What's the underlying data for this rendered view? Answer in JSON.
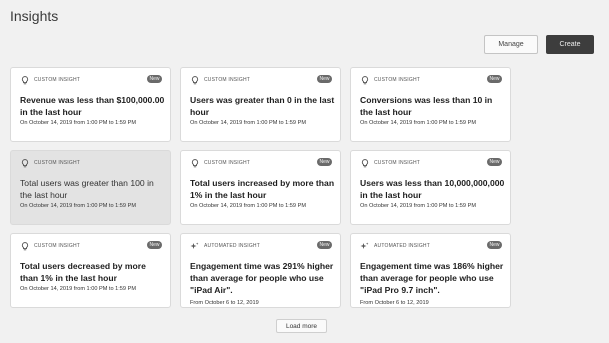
{
  "page": {
    "title": "Insights"
  },
  "toolbar": {
    "manage_label": "Manage",
    "create_label": "Create"
  },
  "cards": [
    {
      "type": "CUSTOM INSIGHT",
      "icon": "lightbulb-icon",
      "badge": "New",
      "title": "Revenue was less than $100,000.00 in the last hour",
      "subtitle": "On October 14, 2019 from 1:00 PM to 1:59 PM",
      "selected": false
    },
    {
      "type": "CUSTOM INSIGHT",
      "icon": "lightbulb-icon",
      "badge": "New",
      "title": "Users was greater than 0 in the last hour",
      "subtitle": "On October 14, 2019 from 1:00 PM to 1:59 PM",
      "selected": false
    },
    {
      "type": "CUSTOM INSIGHT",
      "icon": "lightbulb-icon",
      "badge": "New",
      "title": "Conversions was less than 10 in the last hour",
      "subtitle": "On October 14, 2019 from 1:00 PM to 1:59 PM",
      "selected": false
    },
    {
      "type": "CUSTOM INSIGHT",
      "icon": "lightbulb-icon",
      "badge": "",
      "title": "Total users was greater than 100 in the last hour",
      "subtitle": "On October 14, 2019 from 1:00 PM to 1:59 PM",
      "selected": true
    },
    {
      "type": "CUSTOM INSIGHT",
      "icon": "lightbulb-icon",
      "badge": "New",
      "title": "Total users increased by more than 1% in the last hour",
      "subtitle": "On October 14, 2019 from 1:00 PM to 1:59 PM",
      "selected": false
    },
    {
      "type": "CUSTOM INSIGHT",
      "icon": "lightbulb-icon",
      "badge": "New",
      "title": "Users was less than 10,000,000,000 in the last hour",
      "subtitle": "On October 14, 2019 from 1:00 PM to 1:59 PM",
      "selected": false
    },
    {
      "type": "CUSTOM INSIGHT",
      "icon": "lightbulb-icon",
      "badge": "New",
      "title": "Total users decreased by more than 1% in the last hour",
      "subtitle": "On October 14, 2019 from 1:00 PM to 1:59 PM",
      "selected": false
    },
    {
      "type": "AUTOMATED INSIGHT",
      "icon": "sparkle-icon",
      "badge": "New",
      "title": "Engagement time was 291% higher than average for people who use \"iPad Air\".",
      "subtitle": "From October 6 to 12, 2019",
      "selected": false
    },
    {
      "type": "AUTOMATED INSIGHT",
      "icon": "sparkle-icon",
      "badge": "New",
      "title": "Engagement time was 186% higher than average for people who use \"iPad Pro 9.7 inch\".",
      "subtitle": "From October 6 to 12, 2019",
      "selected": false
    }
  ],
  "footer": {
    "load_more_label": "Load more"
  },
  "colors": {
    "badge": "#6a6a6a",
    "create_button": "#3d3d3d",
    "selected_card": "#e3e3e3",
    "background": "#f1f1f1"
  }
}
